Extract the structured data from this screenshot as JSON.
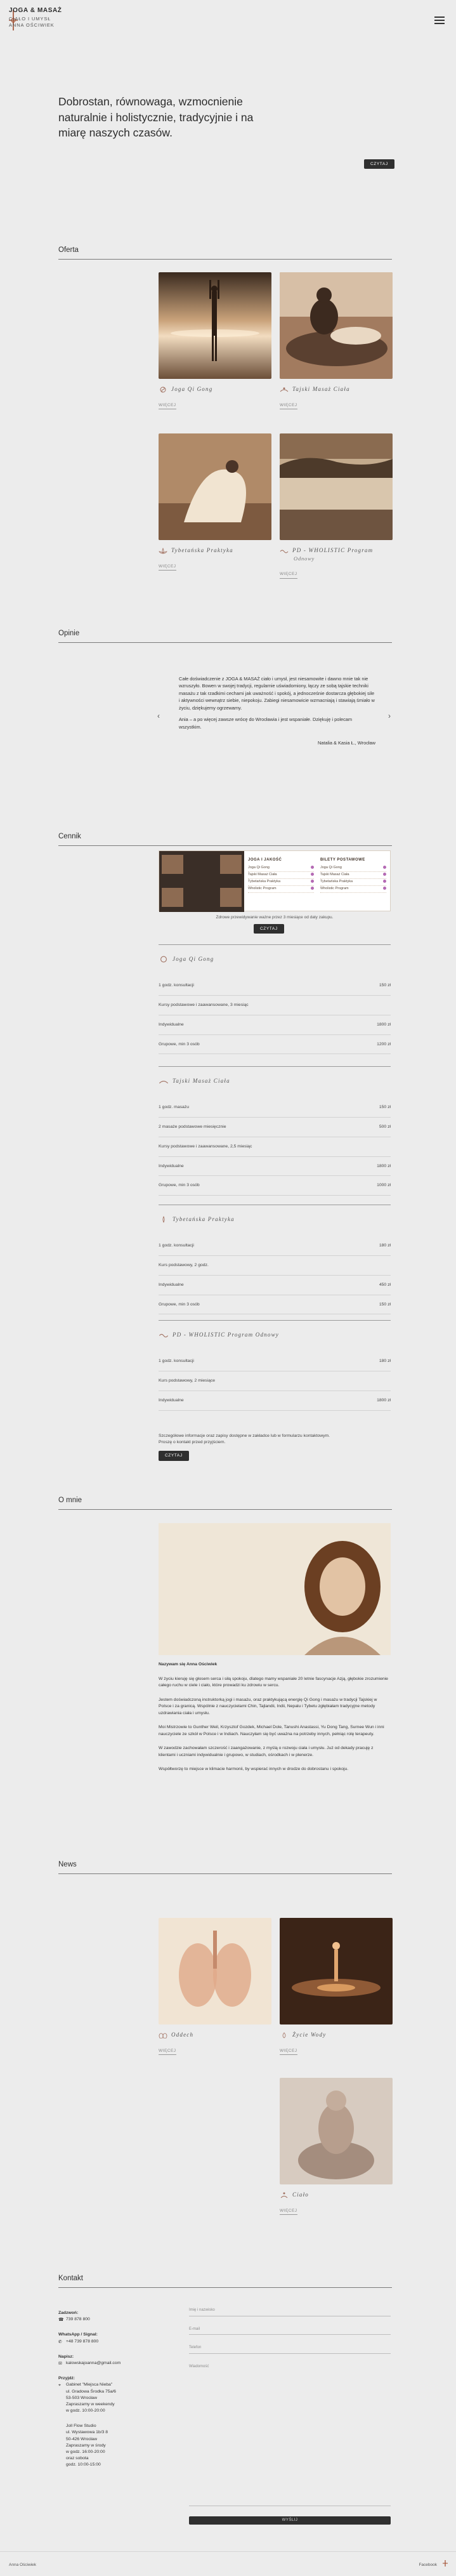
{
  "header": {
    "brand_line1": "JOGA & MASAŻ",
    "brand_line2": "CIAŁO I UMYSŁ",
    "brand_line3": "ANNA OŚCIWIEK"
  },
  "hero": {
    "headline": "Dobrostan, równowaga, wzmocnienie naturalnie i holistycznie, tradycyjnie i na miarę naszych czasów.",
    "button": "CZYTAJ"
  },
  "offer": {
    "heading": "Oferta",
    "more_label": "WIĘCEJ",
    "cards": [
      {
        "title": "Joga Qi Gong",
        "subtitle": ""
      },
      {
        "title": "Tajski Masaż Ciała",
        "subtitle": ""
      },
      {
        "title": "Tybetańska Praktyka",
        "subtitle": ""
      },
      {
        "title": "PD - WHOLISTIC Program",
        "subtitle": "Odnowy"
      }
    ]
  },
  "opinions": {
    "heading": "Opinie",
    "p1": "Całe doświadczenie z JOGA & MASAŻ ciało i umysł, jest niesamowite i dawno mnie tak nie wzruszyło. Bowen w swojej tradycji, regularnie uświadomiony, łączy ze sobą tajskie techniki masażu z tak rzadkimi cechami jak uważność i spokój, a jednocześnie dostarcza głębokiej sile i aktywności wewnątrz siebie, niepokoju. Zabiegi niesamowicie wzmacniają i stawiają śmiało w życiu, dziękujemy ogrzewamy.",
    "p2": "Ania – a po więcej zawsze wrócę do Wrocławia i jest wspaniałe. Dziękuję i polecam wszystkim.",
    "signature": "Natalia & Kasia Ł., Wrocław"
  },
  "pricing": {
    "heading": "Cennik",
    "banner": {
      "col1_title": "JOGA I JAKOŚĆ",
      "col2_title": "BILETY POSTAWOWE",
      "col1_rows": [
        "Joga Qi Gong",
        "Tajski Masaż Ciała",
        "Tybetańska Praktyka",
        "Wholistic Program"
      ],
      "col2_rows": [
        "Joga Qi Gong",
        "Tajski Masaż Ciała",
        "Tybetańska Praktyka",
        "Wholistic Program"
      ]
    },
    "note": "Zdrowe przewidywanie ważne przez 3 miesiące od daty zakupu.",
    "banner_button": "CZYTAJ",
    "categories": [
      {
        "title": "Joga Qi Gong",
        "rows": [
          {
            "label": "1 godz. konsultacji",
            "price": "150 zł"
          },
          {
            "label": "Kursy podstawowe i zaawansowane, 3 miesiąc",
            "price": ""
          },
          {
            "label": "Indywidualne",
            "price": "1800 zł"
          },
          {
            "label": "Grupowe, min 3 osób",
            "price": "1200 zł"
          }
        ]
      },
      {
        "title": "Tajski Masaż Ciała",
        "rows": [
          {
            "label": "1 godz. masażu",
            "price": "150 zł"
          },
          {
            "label": "2 masaże podstawowe miesięcznie",
            "price": "500 zł"
          },
          {
            "label": "Kursy podstawowe i zaawansowane, 2,5 miesiąc",
            "price": ""
          },
          {
            "label": "Indywidualne",
            "price": "1800 zł"
          },
          {
            "label": "Grupowe, min 3 osób",
            "price": "1000 zł"
          }
        ]
      },
      {
        "title": "Tybetańska Praktyka",
        "rows": [
          {
            "label": "1 godz. konsultacji",
            "price": "180 zł"
          },
          {
            "label": "Kurs podstawowy, 2 godz.",
            "price": ""
          },
          {
            "label": "Indywidualne",
            "price": "450 zł"
          },
          {
            "label": "Grupowe, min 3 osób",
            "price": "150 zł"
          }
        ]
      },
      {
        "title": "PD - WHOLISTIC Program Odnowy",
        "rows": [
          {
            "label": "1 godz. konsultacji",
            "price": "180 zł"
          },
          {
            "label": "Kurs podstawowy, 2 miesiące",
            "price": ""
          },
          {
            "label": "Indywidualne",
            "price": "1800 zł"
          }
        ]
      }
    ],
    "footnote1": "Szczegółowe informacje oraz zapisy dostępne w zakładce lub w formularzu kontaktowym.",
    "footnote2": "Proszę o kontakt przed przyjściem.",
    "footnote_button": "CZYTAJ"
  },
  "about": {
    "heading": "O mnie",
    "intro": "Nazywam się Anna Ościwiek",
    "paragraphs": [
      "W życiu kieruję się głosem serca i siłą spokoju, dlatego mamy wspaniałe 20 letnie fascynacje Azją, głębokie zrozumienie całego ruchu w ciele i ciało, które prowadzi ku zdrowiu w sercu.",
      "Jestem doświadczoną instruktorką jogi i masażu, oraz praktykującą energię Qi Gong i masażu w tradycji Tajskiej w Polsce i za granicą. Wspólnie z nauczycielami Chin, Tajlandii, Indii, Nepalu i Tybetu zgłębiałam tradycyjne metody uzdrawiania ciała i umysłu.",
      "Moi Mistrzowie to Gunther Weil, Krzysztof Gozdek, Michael Dole, Tanushi Anastassi, Yu Dong Tang, Surnee Wun i inni nauczyciele ze szkół w Polsce i w Indiach. Nauczyłam się być uważna na potrzeby innych, pełniąc rolę terapeuty.",
      "W zawodzie zachowałam szczerość i zaangażowanie, z myślą o rozwoju ciała i umysłu. Już od dekady pracuję z klientami i uczniami indywidualnie i grupowo, w studiach, ośrodkach i w plenerze.",
      "Współtworzę to miejsce w klimacie harmonii, by wspierać innych w drodze do dobrostanu i spokoju."
    ]
  },
  "news": {
    "heading": "News",
    "more_label": "WIĘCEJ",
    "items": [
      {
        "title": "Oddech"
      },
      {
        "title": "Życie Wody"
      },
      {
        "title": "Ciało"
      }
    ]
  },
  "contact": {
    "heading": "Kontakt",
    "phone_label": "Zadzwoń:",
    "phone": "739 878 800",
    "messenger_label": "WhatsApp / Signal:",
    "messenger": "+48 739 878 800",
    "email_label": "Napisz:",
    "email": "kalowskajoanna@gmail.com",
    "visit_label": "Przyjdź:",
    "studio1_name": "Gabinet \"Miejsca Nieba\"",
    "studio1_street": "ul. Gradowa Środka 75a/6",
    "studio1_city": "53-503 Wrocław",
    "studio1_hours": "Zapraszamy w weekendy",
    "studio1_time": "w godz. 10:00-20:00",
    "studio2_name": "Joll Flow Studio",
    "studio2_street": "ul. Wystawowa 1b/3 8",
    "studio2_city": "50-426 Wrocław",
    "studio2_hours": "Zapraszamy w środy",
    "studio2_time": "w godz. 16:00-20:00",
    "studio2_extra1": "oraz sobota",
    "studio2_extra2": "godz. 10:00-15:00",
    "form": {
      "name_placeholder": "Imię i nazwisko",
      "email_placeholder": "E-mail",
      "phone_placeholder": "Telefon",
      "message_placeholder": "Wiadomość",
      "submit": "WYŚLIJ"
    }
  },
  "footer": {
    "left": "Anna Ościwiek",
    "right": "Facebook"
  },
  "colors": {
    "accent_dark": "#2f2f2f",
    "sepia": "#8d6b52",
    "background": "#ececec"
  }
}
